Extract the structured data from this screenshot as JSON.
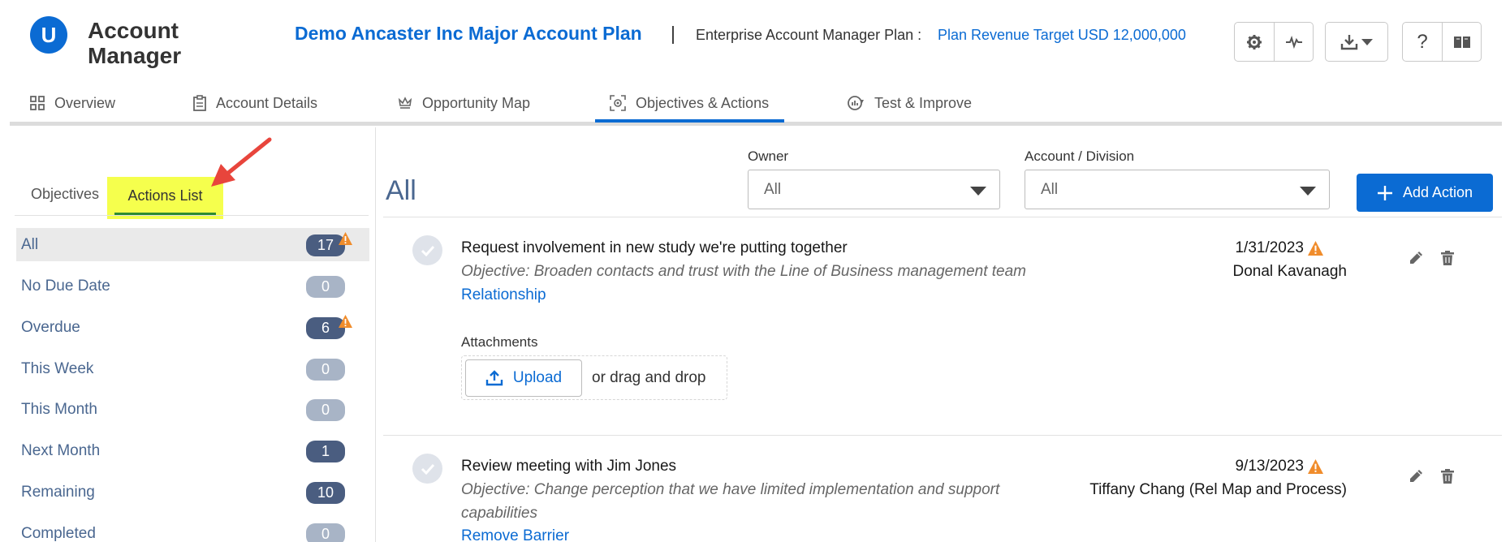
{
  "header": {
    "logo_letter": "U",
    "app_title_line1": "Account",
    "app_title_line2": "Manager",
    "plan_title": "Demo Ancaster Inc Major Account Plan",
    "plan_separator": "|",
    "plan_type": "Enterprise Account Manager Plan :",
    "plan_target": "Plan Revenue Target USD 12,000,000",
    "toolbar_icons": [
      "gear-icon",
      "activity-icon",
      "download-icon",
      "help-icon",
      "book-icon"
    ]
  },
  "tabs": [
    {
      "label": "Overview",
      "icon": "grid-icon"
    },
    {
      "label": "Account Details",
      "icon": "clipboard-icon"
    },
    {
      "label": "Opportunity Map",
      "icon": "crown-icon"
    },
    {
      "label": "Objectives & Actions",
      "icon": "target-icon",
      "active": true
    },
    {
      "label": "Test & Improve",
      "icon": "chart-cycle-icon"
    }
  ],
  "sidebar": {
    "subtabs": [
      {
        "label": "Objectives"
      },
      {
        "label": "Actions List",
        "active": true
      }
    ],
    "filters": [
      {
        "label": "All",
        "count": "17",
        "warning": true
      },
      {
        "label": "No Due Date",
        "count": "0",
        "warning": false
      },
      {
        "label": "Overdue",
        "count": "6",
        "warning": true
      },
      {
        "label": "This Week",
        "count": "0",
        "warning": false
      },
      {
        "label": "This Month",
        "count": "0",
        "warning": false
      },
      {
        "label": "Next Month",
        "count": "1",
        "warning": false
      },
      {
        "label": "Remaining",
        "count": "10",
        "warning": false
      },
      {
        "label": "Completed",
        "count": "0",
        "warning": false
      }
    ]
  },
  "main": {
    "view_title": "All",
    "owner_label": "Owner",
    "owner_value": "All",
    "account_label": "Account / Division",
    "account_value": "All",
    "add_action_label": "Add Action",
    "actions": [
      {
        "title": "Request involvement in new study we're putting together",
        "objective": "Objective: Broaden contacts and trust with the Line of Business management team",
        "tag": "Relationship",
        "date": "1/31/2023",
        "owner": "Donal Kavanagh",
        "attachments_label": "Attachments",
        "upload_label": "Upload",
        "drag_text": "or drag and drop"
      },
      {
        "title": "Review meeting with Jim Jones",
        "objective": "Objective: Change perception that we have limited implementation and support capabilities",
        "tag": "Remove Barrier",
        "date": "9/13/2023",
        "owner": "Tiffany Chang (Rel Map and Process)"
      }
    ]
  },
  "colors": {
    "brand_blue": "#0b6bd3",
    "badge_dark": "#4a5d80",
    "badge_light": "#a8b4c6",
    "warning_orange": "#f08c2b",
    "highlight_yellow": "#f5ff4d",
    "annotation_red": "#e8453c"
  }
}
